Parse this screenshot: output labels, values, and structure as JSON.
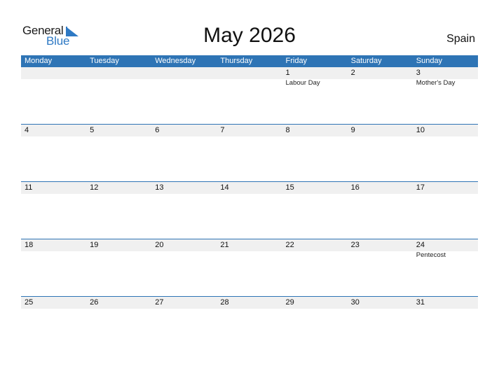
{
  "brand": {
    "line1": "General",
    "line2": "Blue",
    "accent": "#2e79c4"
  },
  "title": "May 2026",
  "country": "Spain",
  "colors": {
    "header_bg": "#2e74b5",
    "row_band": "#f0f0f0"
  },
  "weekdays": [
    "Monday",
    "Tuesday",
    "Wednesday",
    "Thursday",
    "Friday",
    "Saturday",
    "Sunday"
  ],
  "weeks": [
    {
      "days": [
        {
          "num": "",
          "holiday": ""
        },
        {
          "num": "",
          "holiday": ""
        },
        {
          "num": "",
          "holiday": ""
        },
        {
          "num": "",
          "holiday": ""
        },
        {
          "num": "1",
          "holiday": "Labour Day"
        },
        {
          "num": "2",
          "holiday": ""
        },
        {
          "num": "3",
          "holiday": "Mother's Day"
        }
      ]
    },
    {
      "days": [
        {
          "num": "4",
          "holiday": ""
        },
        {
          "num": "5",
          "holiday": ""
        },
        {
          "num": "6",
          "holiday": ""
        },
        {
          "num": "7",
          "holiday": ""
        },
        {
          "num": "8",
          "holiday": ""
        },
        {
          "num": "9",
          "holiday": ""
        },
        {
          "num": "10",
          "holiday": ""
        }
      ]
    },
    {
      "days": [
        {
          "num": "11",
          "holiday": ""
        },
        {
          "num": "12",
          "holiday": ""
        },
        {
          "num": "13",
          "holiday": ""
        },
        {
          "num": "14",
          "holiday": ""
        },
        {
          "num": "15",
          "holiday": ""
        },
        {
          "num": "16",
          "holiday": ""
        },
        {
          "num": "17",
          "holiday": ""
        }
      ]
    },
    {
      "days": [
        {
          "num": "18",
          "holiday": ""
        },
        {
          "num": "19",
          "holiday": ""
        },
        {
          "num": "20",
          "holiday": ""
        },
        {
          "num": "21",
          "holiday": ""
        },
        {
          "num": "22",
          "holiday": ""
        },
        {
          "num": "23",
          "holiday": ""
        },
        {
          "num": "24",
          "holiday": "Pentecost"
        }
      ]
    },
    {
      "days": [
        {
          "num": "25",
          "holiday": ""
        },
        {
          "num": "26",
          "holiday": ""
        },
        {
          "num": "27",
          "holiday": ""
        },
        {
          "num": "28",
          "holiday": ""
        },
        {
          "num": "29",
          "holiday": ""
        },
        {
          "num": "30",
          "holiday": ""
        },
        {
          "num": "31",
          "holiday": ""
        }
      ]
    }
  ]
}
